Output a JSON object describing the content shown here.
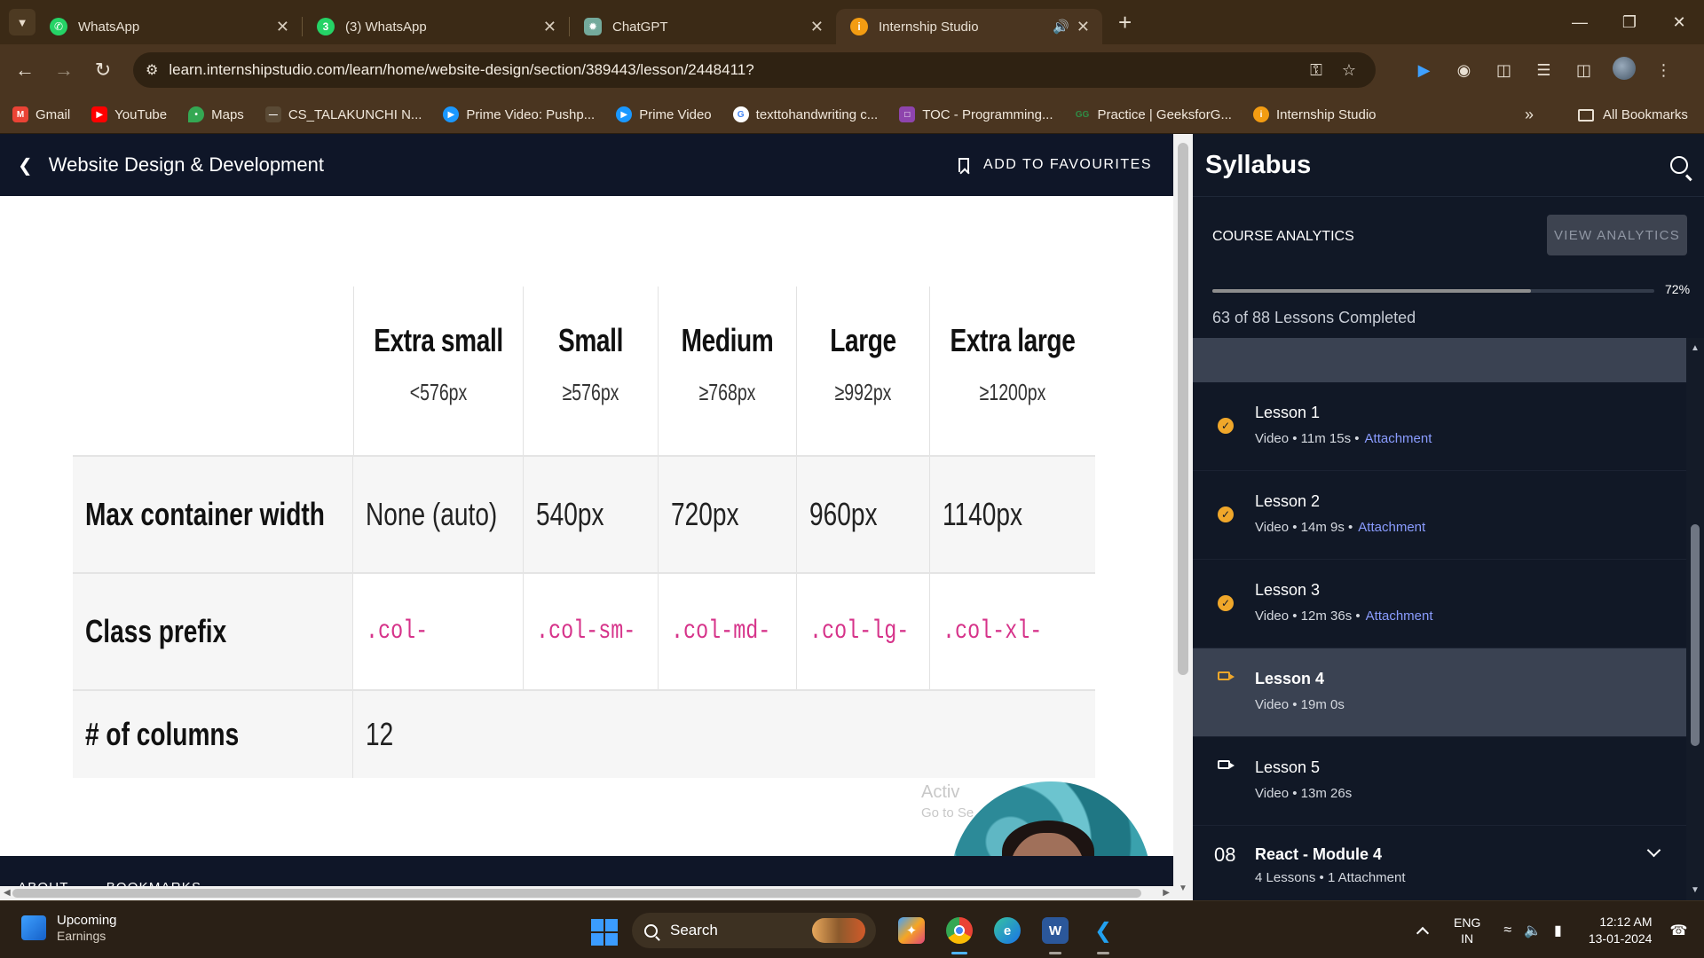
{
  "browser": {
    "tabs": [
      {
        "title": "WhatsApp",
        "icon": "whatsapp-icon",
        "color": "#25d366"
      },
      {
        "title": "(3) WhatsApp",
        "icon": "whatsapp-icon",
        "color": "#25d366",
        "badge": "3"
      },
      {
        "title": "ChatGPT",
        "icon": "chatgpt-icon",
        "color": "#74aa9c"
      },
      {
        "title": "Internship Studio",
        "icon": "internship-studio-icon",
        "color": "#f39c12",
        "active": true
      }
    ],
    "url": "learn.internshipstudio.com/learn/home/website-design/section/389443/lesson/2448411?",
    "bookmarks": [
      {
        "label": "Gmail",
        "icon": "gmail-icon",
        "color": "#ea4335"
      },
      {
        "label": "YouTube",
        "icon": "youtube-icon",
        "color": "#ff0000"
      },
      {
        "label": "Maps",
        "icon": "maps-icon",
        "color": "#34a853"
      },
      {
        "label": "CS_TALAKUNCHI N...",
        "icon": "bookmark-page-icon",
        "color": "#5a4a35"
      },
      {
        "label": "Prime Video: Pushp...",
        "icon": "prime-video-icon",
        "color": "#1a98ff"
      },
      {
        "label": "Prime Video",
        "icon": "prime-video-icon",
        "color": "#1a98ff"
      },
      {
        "label": "texttohandwriting c...",
        "icon": "google-icon",
        "color": "#4285f4"
      },
      {
        "label": "TOC - Programming...",
        "icon": "toc-icon",
        "color": "#8e44ad"
      },
      {
        "label": "Practice | GeeksforG...",
        "icon": "geeksforgeeks-icon",
        "color": "#2f8d46"
      },
      {
        "label": "Internship Studio",
        "icon": "internship-studio-icon",
        "color": "#f39c12"
      }
    ],
    "all_bookmarks": "All Bookmarks"
  },
  "course": {
    "title": "Website Design & Development",
    "add_favourites": "ADD TO FAVOURITES"
  },
  "slide": {
    "headers": [
      {
        "name": "Extra small",
        "size": "<576px"
      },
      {
        "name": "Small",
        "size": "≥576px"
      },
      {
        "name": "Medium",
        "size": "≥768px"
      },
      {
        "name": "Large",
        "size": "≥992px"
      },
      {
        "name": "Extra large",
        "size": "≥1200px"
      }
    ],
    "rows": [
      {
        "label": "Max container width",
        "cells": [
          "None (auto)",
          "540px",
          "720px",
          "960px",
          "1140px"
        ]
      },
      {
        "label": "Class prefix",
        "cells": [
          ".col-",
          ".col-sm-",
          ".col-md-",
          ".col-lg-",
          ".col-xl-"
        ]
      },
      {
        "label": "# of columns",
        "cells": [
          "12"
        ]
      }
    ],
    "watermark_line1": "Activ",
    "watermark_line2": "Go to Se"
  },
  "footer": {
    "about": "ABOUT",
    "bookmarks": "BOOKMARKS"
  },
  "syllabus": {
    "title": "Syllabus",
    "analytics_label": "COURSE ANALYTICS",
    "view_analytics": "VIEW ANALYTICS",
    "progress_percent": 72,
    "progress_label": "72%",
    "lessons_completed": "63 of 88 Lessons Completed",
    "lessons": [
      {
        "title": "Lesson 1",
        "meta": "Video • 11m 15s •",
        "attachment": "Attachment",
        "status": "completed"
      },
      {
        "title": "Lesson 2",
        "meta": "Video • 14m 9s •",
        "attachment": "Attachment",
        "status": "completed"
      },
      {
        "title": "Lesson 3",
        "meta": "Video • 12m 36s •",
        "attachment": "Attachment",
        "status": "completed"
      },
      {
        "title": "Lesson 4",
        "meta": "Video • 19m 0s",
        "attachment": "",
        "status": "current"
      },
      {
        "title": "Lesson 5",
        "meta": "Video • 13m 26s",
        "attachment": "",
        "status": "pending"
      }
    ],
    "module": {
      "number": "08",
      "title": "React - Module 4",
      "meta": "4 Lessons • 1 Attachment"
    }
  },
  "taskbar": {
    "widget_title": "Upcoming",
    "widget_sub": "Earnings",
    "search": "Search",
    "lang_top": "ENG",
    "lang_bottom": "IN",
    "time": "12:12 AM",
    "date": "13-01-2024"
  }
}
